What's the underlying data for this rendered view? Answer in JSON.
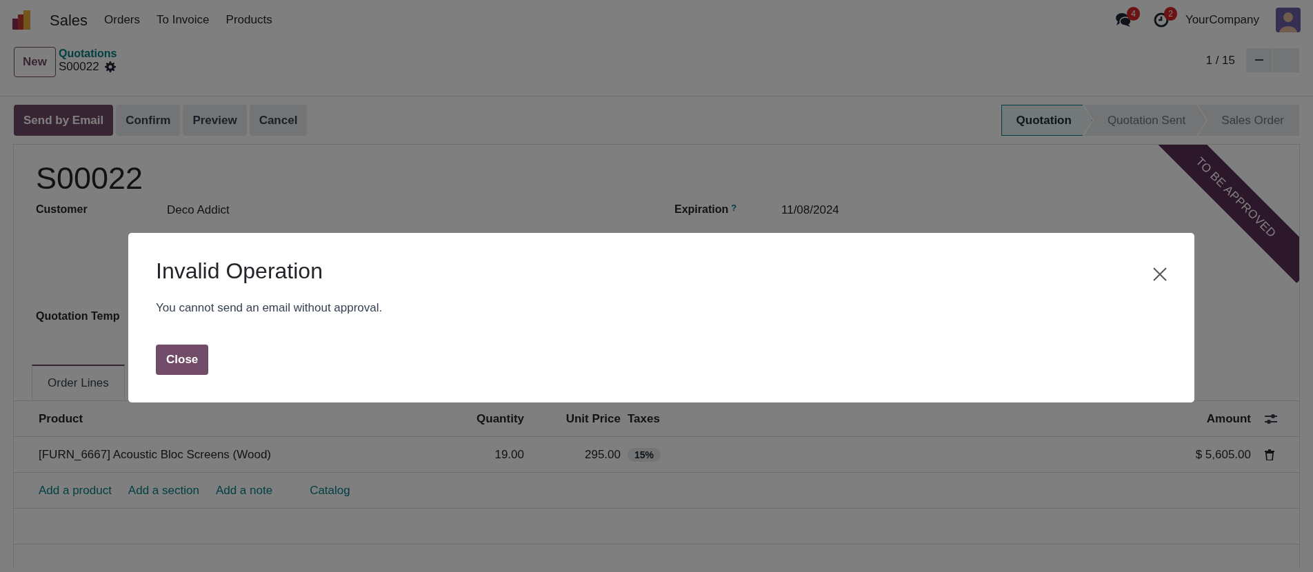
{
  "navbar": {
    "app": "Sales",
    "menu": [
      "Orders",
      "To Invoice",
      "Products"
    ],
    "messages_count": "4",
    "activities_count": "2",
    "company": "YourCompany"
  },
  "control_panel": {
    "new_button": "New",
    "breadcrumb": "Quotations",
    "record": "S00022",
    "pager": "1 / 15"
  },
  "actions": [
    {
      "label": "Send by Email",
      "primary": true
    },
    {
      "label": "Confirm",
      "primary": false
    },
    {
      "label": "Preview",
      "primary": false
    },
    {
      "label": "Cancel",
      "primary": false
    }
  ],
  "statusbar": [
    {
      "label": "Quotation",
      "selected": true
    },
    {
      "label": "Quotation Sent",
      "selected": false
    },
    {
      "label": "Sales Order",
      "selected": false
    }
  ],
  "sheet": {
    "ribbon": "TO BE APPROVED",
    "title": "S00022",
    "left_fields": [
      {
        "label": "Customer",
        "value": "Deco Addict"
      },
      {
        "label": "Quotation Temp"
      }
    ],
    "right_fields": [
      {
        "label": "Expiration",
        "help": "?",
        "value": "11/08/2024"
      }
    ],
    "tabs": [
      {
        "label": "Order Lines",
        "selected": true
      }
    ],
    "columns": [
      "Product",
      "Quantity",
      "Unit Price",
      "Taxes",
      "Amount"
    ],
    "rows": [
      {
        "product": "[FURN_6667] Acoustic Bloc Screens (Wood)",
        "quantity": "19.00",
        "unit_price": "295.00",
        "taxes": "15%",
        "amount": "$ 5,605.00"
      }
    ],
    "add_links": [
      "Add a product",
      "Add a section",
      "Add a note",
      "Catalog"
    ]
  },
  "dialog": {
    "title": "Invalid Operation",
    "message": "You cannot send an email without approval.",
    "close_button": "Close"
  }
}
